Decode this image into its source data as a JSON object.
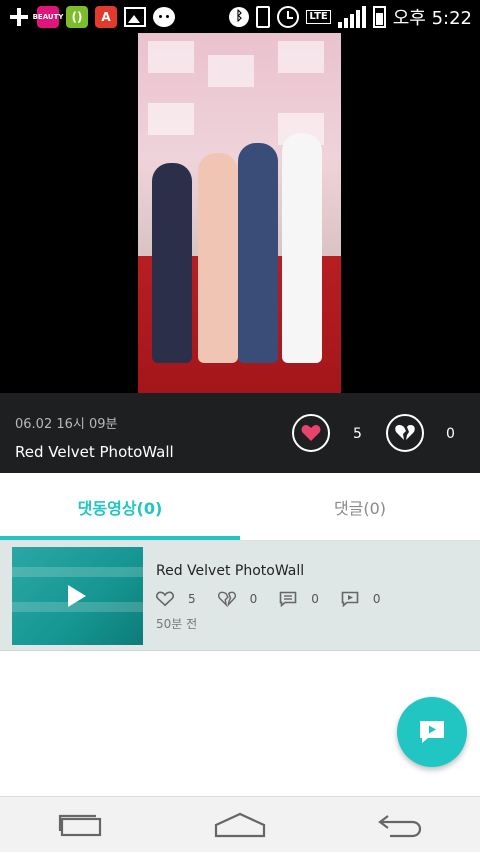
{
  "status_bar": {
    "time": "오후 5:22",
    "network": "LTE",
    "app_icons": [
      {
        "name": "add-icon"
      },
      {
        "name": "beauty-app-icon",
        "color": "#e0157a"
      },
      {
        "name": "olive-app-icon",
        "color": "#7cbd2a"
      },
      {
        "name": "a-app-icon",
        "color": "#e23b2e"
      },
      {
        "name": "gallery-icon"
      },
      {
        "name": "bear-app-icon"
      }
    ]
  },
  "video": {
    "date": "06.02 16시 09분",
    "title": "Red Velvet PhotoWall",
    "likes": "5",
    "dislikes": "0"
  },
  "tabs": [
    {
      "label": "댓동영상(0)",
      "active": true
    },
    {
      "label": "댓글(0)",
      "active": false
    }
  ],
  "list": [
    {
      "title": "Red Velvet PhotoWall",
      "likes": "5",
      "dislikes": "0",
      "comments": "0",
      "replies": "0",
      "time": "50분 전"
    }
  ],
  "colors": {
    "accent": "#21c6c3",
    "info_bg": "#1d1f21",
    "like_heart": "#e8436a"
  }
}
